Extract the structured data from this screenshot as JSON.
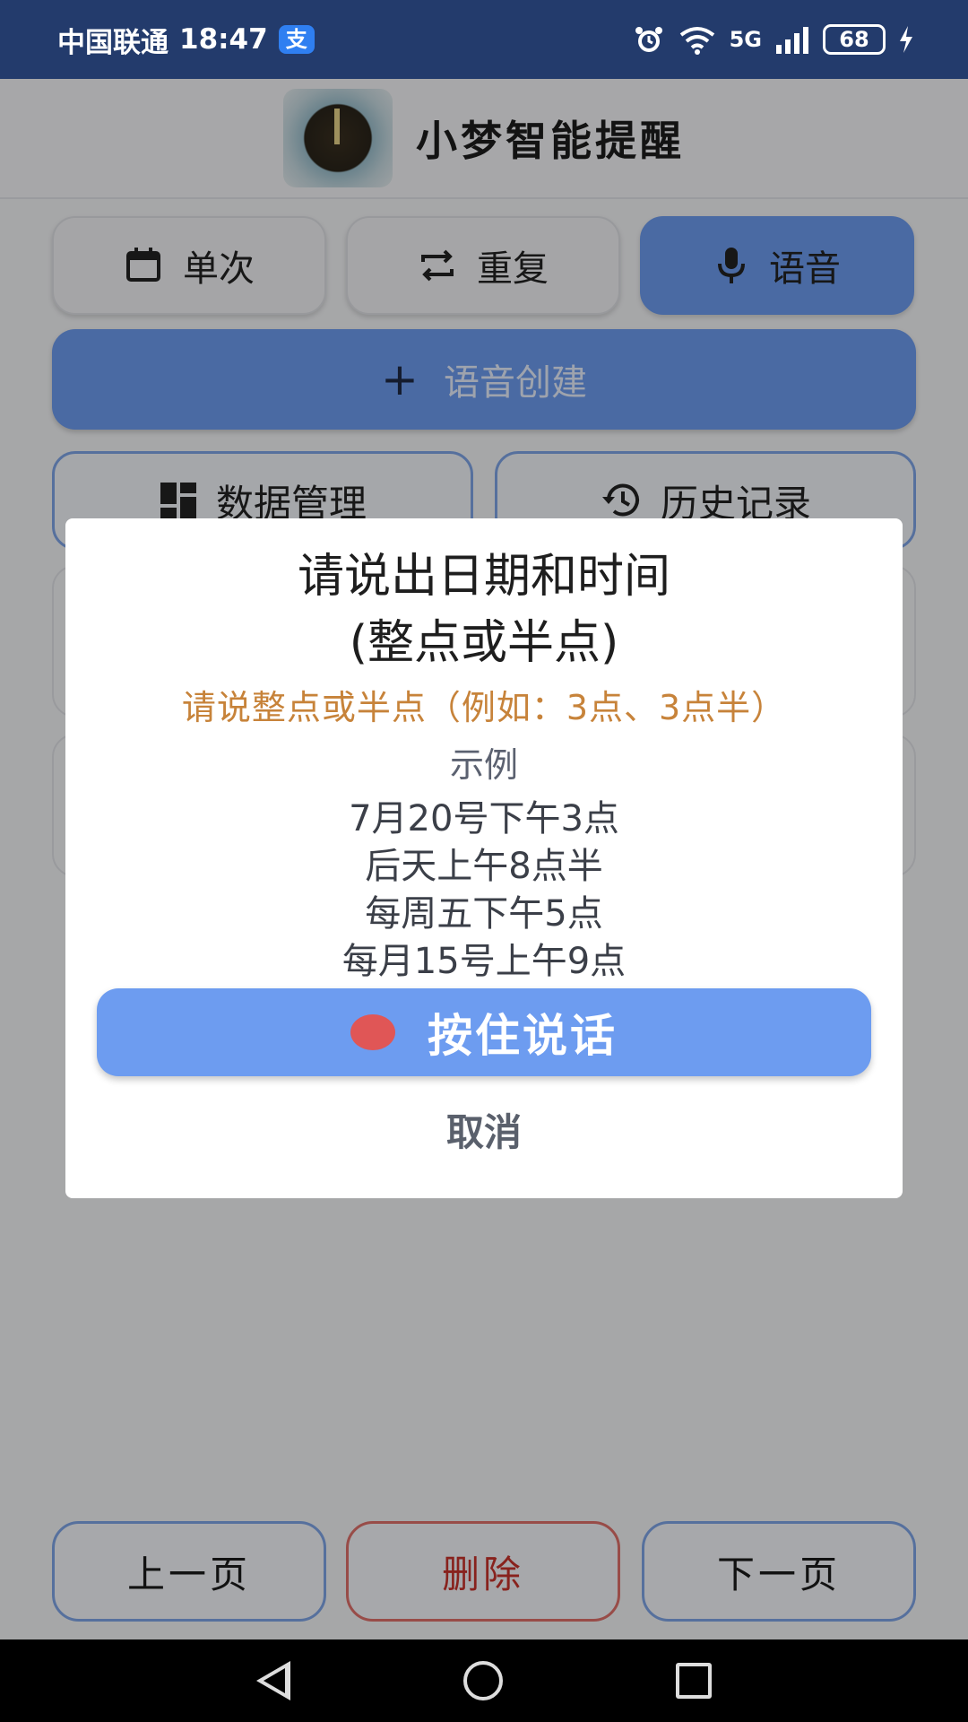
{
  "status_bar": {
    "carrier": "中国联通",
    "time": "18:47",
    "alipay_icon": "支",
    "net_label": "5G",
    "battery": "68"
  },
  "app": {
    "title": "小梦智能提醒"
  },
  "tabs": [
    {
      "label": "单次",
      "icon": "calendar-icon"
    },
    {
      "label": "重复",
      "icon": "repeat-icon"
    },
    {
      "label": "语音",
      "icon": "microphone-icon",
      "active": true
    }
  ],
  "create_button": {
    "label": "语音创建"
  },
  "tools": {
    "data_manage": "数据管理",
    "history": "历史记录"
  },
  "bottom": {
    "prev": "上一页",
    "delete": "删除",
    "next": "下一页"
  },
  "dialog": {
    "title_line1": "请说出日期和时间",
    "title_line2": "(整点或半点)",
    "hint": "请说整点或半点（例如：3点、3点半）",
    "examples_heading": "示例",
    "examples": [
      "7月20号下午3点",
      "后天上午8点半",
      "每周五下午5点",
      "每月15号上午9点"
    ],
    "press_button": "按住说话",
    "cancel": "取消"
  },
  "colors": {
    "status_bar": "#233b6c",
    "primary": "#6d9cf0",
    "hint": "#c7833a",
    "danger": "#c9332c",
    "record_dot": "#e05656"
  }
}
